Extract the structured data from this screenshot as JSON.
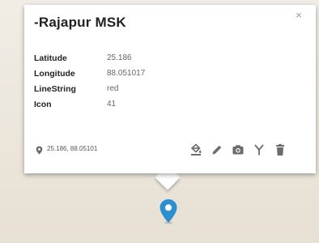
{
  "popup": {
    "title": "-Rajapur MSK",
    "close_label": "×",
    "properties": [
      {
        "key": "Latitude",
        "value": "25.186"
      },
      {
        "key": "Longitude",
        "value": "88.051017"
      },
      {
        "key": "LineString",
        "value": "red"
      },
      {
        "key": "Icon",
        "value": "41"
      }
    ],
    "footer_coords": "25.186, 88.05101"
  },
  "icons": {
    "location": "location-pin-icon",
    "actions": [
      "paint-bucket-icon",
      "pencil-icon",
      "camera-icon",
      "route-icon",
      "trash-icon"
    ],
    "map_marker": "map-marker-icon"
  },
  "colors": {
    "marker": "#2b8fd0",
    "icon_gray": "#6b6b6b"
  }
}
